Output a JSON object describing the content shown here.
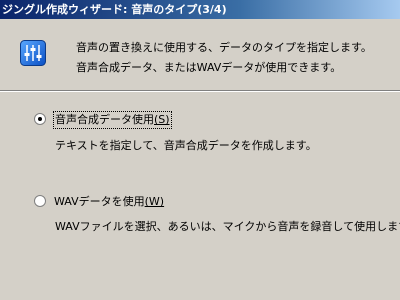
{
  "window": {
    "title": "ジングル作成ウィザード: 音声のタイプ(3/4)"
  },
  "header": {
    "icon": "mixer-sliders-icon",
    "line1": "音声の置き換えに使用する、データのタイプを指定します。",
    "line2": "音声合成データ、またはWAVデータが使用できます。"
  },
  "options": [
    {
      "label": "音声合成データ使用",
      "mnemonic": "(S)",
      "selected": true,
      "description": "テキストを指定して、音声合成データを作成します。"
    },
    {
      "label": "WAVデータを使用",
      "mnemonic": "(W)",
      "selected": false,
      "description": "WAVファイルを選択、あるいは、マイクから音声を録音して使用します。"
    }
  ]
}
